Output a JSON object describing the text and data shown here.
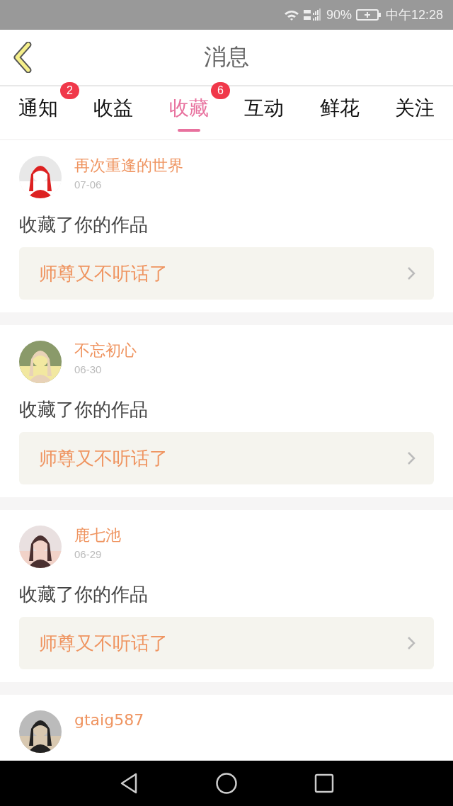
{
  "status_bar": {
    "battery": "90%",
    "time": "中午12:28"
  },
  "header": {
    "title": "消息"
  },
  "tabs": [
    {
      "label": "通知",
      "selected": false,
      "badge": "2"
    },
    {
      "label": "收益",
      "selected": false
    },
    {
      "label": "收藏",
      "selected": true,
      "badge": "6"
    },
    {
      "label": "互动",
      "selected": false
    },
    {
      "label": "鲜花",
      "selected": false
    },
    {
      "label": "关注",
      "selected": false
    }
  ],
  "messages": [
    {
      "name": "再次重逢的世界",
      "date": "07-06",
      "action": "收藏了你的作品",
      "work": "师尊又不听话了"
    },
    {
      "name": "不忘初心",
      "date": "06-30",
      "action": "收藏了你的作品",
      "work": "师尊又不听话了"
    },
    {
      "name": "鹿七池",
      "date": "06-29",
      "action": "收藏了你的作品",
      "work": "师尊又不听话了"
    },
    {
      "name": "gtaig587"
    }
  ]
}
